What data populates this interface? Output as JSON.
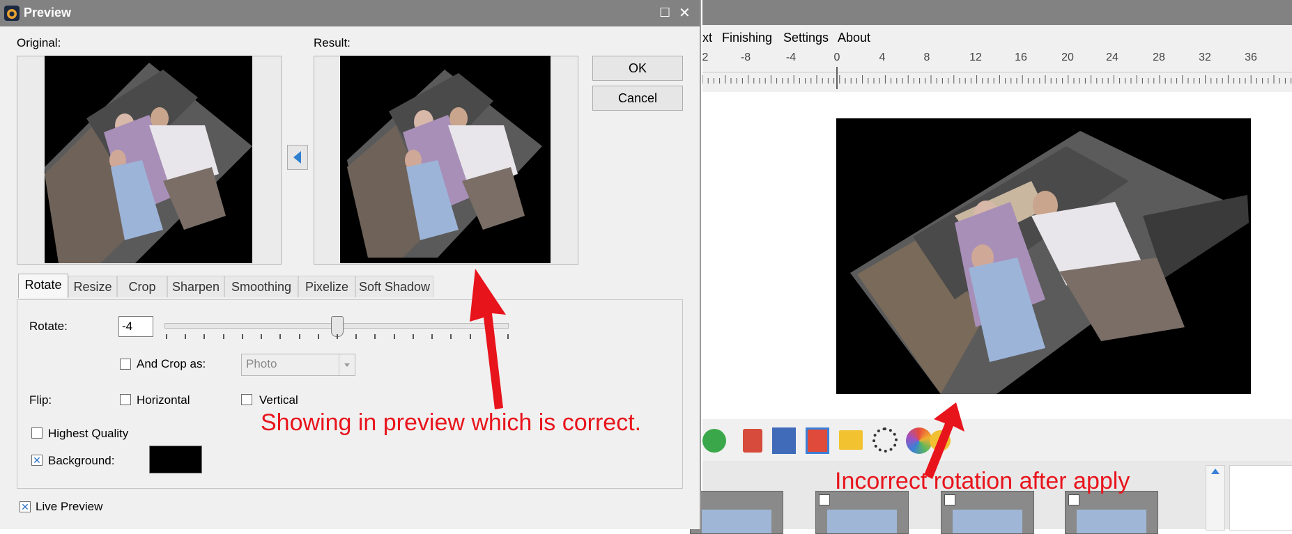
{
  "dialog": {
    "title": "Preview",
    "original_label": "Original:",
    "result_label": "Result:",
    "ok_label": "OK",
    "cancel_label": "Cancel",
    "tabs": [
      {
        "label": "Rotate",
        "active": true
      },
      {
        "label": "Resize"
      },
      {
        "label": "Crop"
      },
      {
        "label": "Sharpen"
      },
      {
        "label": "Smoothing"
      },
      {
        "label": "Pixelize"
      },
      {
        "label": "Soft Shadow"
      }
    ],
    "rotate_label": "Rotate:",
    "rotate_value": "-4",
    "slider_fraction": 0.5,
    "crop_label": "And Crop as:",
    "crop_select_value": "Photo",
    "flip_label": "Flip:",
    "horizontal_label": "Horizontal",
    "vertical_label": "Vertical",
    "highest_quality_label": "Highest Quality",
    "background_label": "Background:",
    "background_checked": true,
    "background_color": "#000000",
    "live_preview_label": "Live Preview",
    "live_preview_checked": true
  },
  "app": {
    "menu": [
      "xt",
      "Finishing",
      "Settings",
      "About"
    ],
    "ruler_labels": [
      "2",
      "-8",
      "-4",
      "0",
      "4",
      "8",
      "12",
      "16",
      "20",
      "24",
      "28",
      "32",
      "36"
    ]
  },
  "annotations": {
    "preview_note": "Showing in preview which is correct.",
    "apply_note": "Incorrect rotation after apply",
    "color": "#e8141c"
  },
  "icons": [
    "window-icon",
    "maximize-icon",
    "close-icon",
    "triangle-left-icon",
    "dropdown-arrow-icon",
    "checkmark-icon"
  ]
}
